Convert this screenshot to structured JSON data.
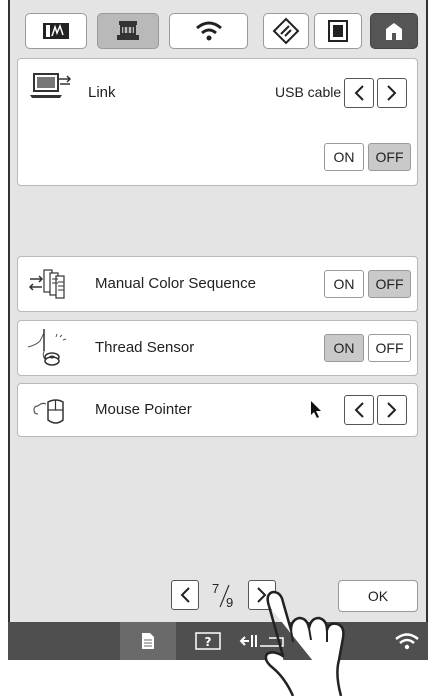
{
  "toolbar": {
    "tabs": [
      {
        "name": "embroidery-screen-icon",
        "selected": false
      },
      {
        "name": "machine-settings-icon",
        "selected": true
      },
      {
        "name": "wireless-icon",
        "selected": false
      },
      {
        "name": "diamond-settings-icon",
        "selected": false
      },
      {
        "name": "frame-icon",
        "selected": false
      },
      {
        "name": "home-icon",
        "selected": false
      }
    ]
  },
  "link": {
    "label": "Link",
    "value": "USB cable",
    "on_label": "ON",
    "off_label": "OFF",
    "selected": "OFF"
  },
  "manual_color_sequence": {
    "label": "Manual Color Sequence",
    "on_label": "ON",
    "off_label": "OFF",
    "selected": "OFF"
  },
  "thread_sensor": {
    "label": "Thread Sensor",
    "on_label": "ON",
    "off_label": "OFF",
    "selected": "ON"
  },
  "mouse_pointer": {
    "label": "Mouse Pointer"
  },
  "pager": {
    "current": "7",
    "total": "9"
  },
  "ok_label": "OK",
  "colors": {
    "screen_bg": "#e4e4e4",
    "selected_button": "#c9c9c9",
    "bottom_bar": "#4f4f4f"
  }
}
